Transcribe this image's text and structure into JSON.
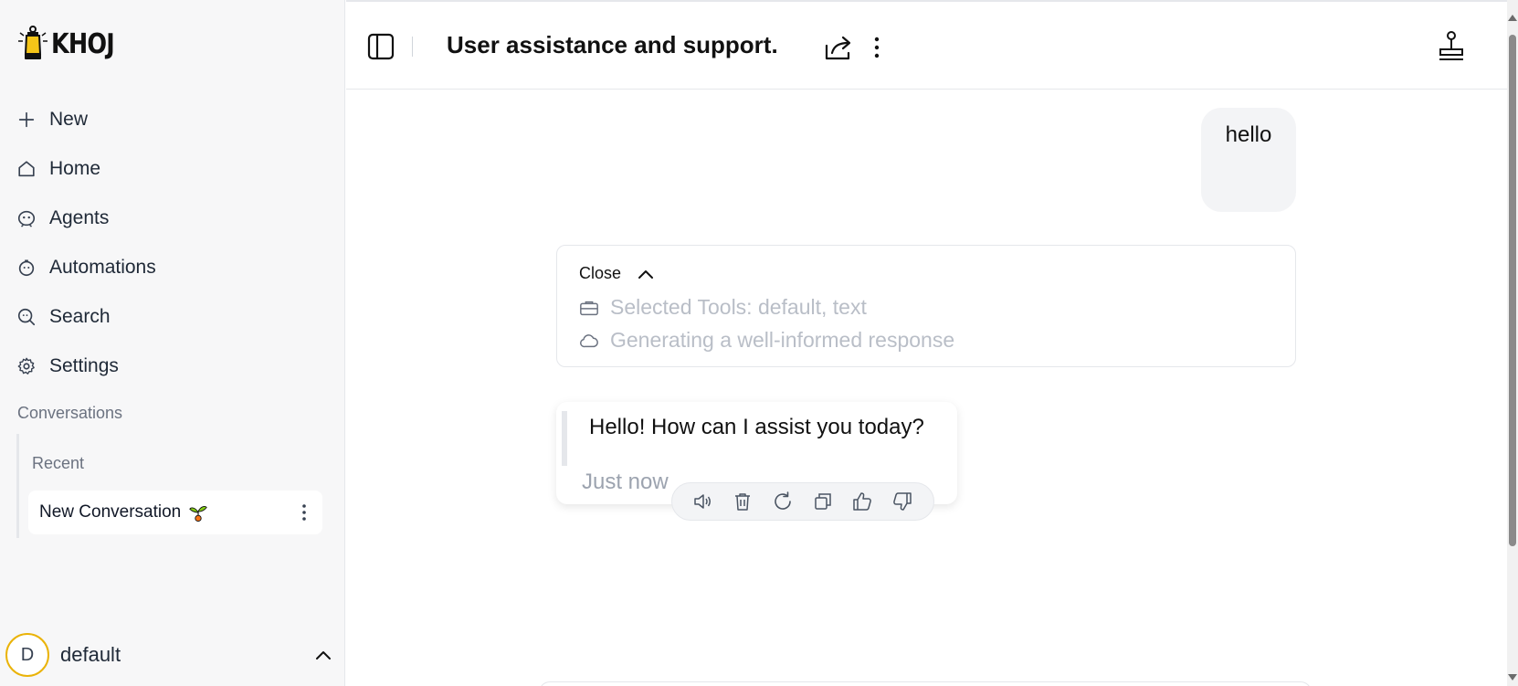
{
  "sidebar": {
    "logo_text": "KHOJ",
    "nav": [
      {
        "label": "New",
        "icon": "plus-icon"
      },
      {
        "label": "Home",
        "icon": "house-icon"
      },
      {
        "label": "Agents",
        "icon": "robot-icon"
      },
      {
        "label": "Automations",
        "icon": "alarm-clock-icon"
      },
      {
        "label": "Search",
        "icon": "search-icon"
      },
      {
        "label": "Settings",
        "icon": "gear-icon"
      }
    ],
    "conversations_heading": "Conversations",
    "recent_label": "Recent",
    "conversation_items": [
      {
        "title": "New Conversation",
        "emoji_icon": "sprout-icon"
      }
    ],
    "user": {
      "initial": "D",
      "name": "default"
    }
  },
  "header": {
    "title": "User assistance and support."
  },
  "chat": {
    "user_message": "hello",
    "tools_panel": {
      "close_label": "Close",
      "steps": [
        {
          "icon": "briefcase-icon",
          "text": "Selected Tools: default, text"
        },
        {
          "icon": "cloud-icon",
          "text": "Generating a well-informed response"
        }
      ]
    },
    "bot_message": {
      "text": "Hello! How can I assist you today?",
      "timestamp": "Just now",
      "actions": [
        "speaker-icon",
        "trash-icon",
        "refresh-icon",
        "copy-icon",
        "thumbs-up-icon",
        "thumbs-down-icon"
      ]
    }
  },
  "colors": {
    "avatar_ring": "#eab308",
    "sidebar_bg": "#f7f7f8",
    "muted_text": "#9ca3af"
  }
}
